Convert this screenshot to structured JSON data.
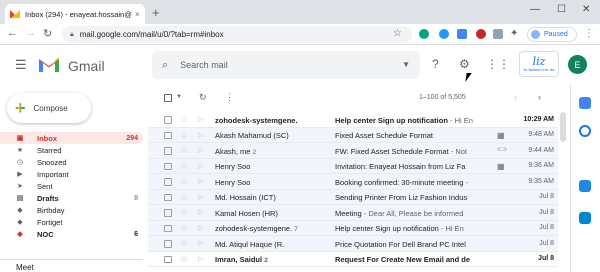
{
  "browser": {
    "tab_title": "Inbox (294) - enayeat.hossain@",
    "tab_close": "×",
    "new_tab": "+",
    "url": "mail.google.com/mail/u/0/?tab=rm#inbox",
    "profile_status": "Paused",
    "win_min": "—",
    "win_max": "☐",
    "win_close": "✕"
  },
  "header": {
    "app_name": "Gmail",
    "search_placeholder": "Search mail",
    "logo_line1": "liz",
    "logo_line2": "liz fashion ind. ltd",
    "avatar_letter": "E"
  },
  "compose": {
    "label": "Compose"
  },
  "sidebar": {
    "items": [
      {
        "label": "Inbox",
        "count": "294",
        "icon": "inbox-icon",
        "glyph": "▣"
      },
      {
        "label": "Starred",
        "count": "",
        "icon": "star-icon",
        "glyph": "★"
      },
      {
        "label": "Snoozed",
        "count": "",
        "icon": "clock-icon",
        "glyph": "◷"
      },
      {
        "label": "Important",
        "count": "",
        "icon": "important-icon",
        "glyph": "▶"
      },
      {
        "label": "Sent",
        "count": "",
        "icon": "send-icon",
        "glyph": "➤"
      },
      {
        "label": "Drafts",
        "count": "8",
        "icon": "draft-icon",
        "glyph": "▤"
      },
      {
        "label": "Birthday",
        "count": "",
        "icon": "label-icon",
        "glyph": "◆"
      },
      {
        "label": "Fortiget",
        "count": "",
        "icon": "label-icon",
        "glyph": "◆"
      },
      {
        "label": "NOC",
        "count": "6",
        "icon": "label-icon",
        "glyph": "◆"
      }
    ],
    "meet": "Meet"
  },
  "list": {
    "range": "1–100 of 5,505",
    "rows": [
      {
        "sender": "zohodesk-systemgene.",
        "count": "",
        "subject": "Help center Sign up notification",
        "snippet": " - Hi En",
        "time": "10:29 AM",
        "unread": true,
        "attach": ""
      },
      {
        "sender": "Akash Mahamud (SC)",
        "count": "",
        "subject": "Fixed Asset Schedule Format",
        "snippet": "",
        "time": "9:48 AM",
        "unread": false,
        "attach": "▦"
      },
      {
        "sender": "Akash, me",
        "count": "2",
        "subject": "FW: Fixed Asset Schedule Format",
        "snippet": " - Not",
        "time": "9:44 AM",
        "unread": false,
        "attach": "⊂⊃"
      },
      {
        "sender": "Henry Soo",
        "count": "",
        "subject": "Invitation: Enayeat Hossain from Liz Fa",
        "snippet": "",
        "time": "9:36 AM",
        "unread": false,
        "attach": "▦"
      },
      {
        "sender": "Henry Soo",
        "count": "",
        "subject": "Booking confirmed: 30-minute meeting",
        "snippet": " -",
        "time": "9:35 AM",
        "unread": false,
        "attach": ""
      },
      {
        "sender": "Md. Hossain (ICT)",
        "count": "",
        "subject": "Sending Printer From Liz Fashion Indus",
        "snippet": "",
        "time": "Jul 8",
        "unread": false,
        "attach": ""
      },
      {
        "sender": "Kamal Hosen (HR)",
        "count": "",
        "subject": "Meeting",
        "snippet": " - Dear All, Please be informed",
        "time": "Jul 8",
        "unread": false,
        "attach": ""
      },
      {
        "sender": "zohodesk-systemgene.",
        "count": "7",
        "subject": "Help center Sign up notification",
        "snippet": " - Hi En",
        "time": "Jul 8",
        "unread": false,
        "attach": ""
      },
      {
        "sender": "Md. Atiqul Haque (R.",
        "count": "",
        "subject": "Price Quotation For Dell Brand PC Intel",
        "snippet": "",
        "time": "Jul 8",
        "unread": false,
        "attach": ""
      },
      {
        "sender": "Imran, Saidul",
        "count": "2",
        "subject": "Request For Create New Email and de",
        "snippet": "",
        "time": "Jul 8",
        "unread": true,
        "attach": ""
      }
    ]
  }
}
